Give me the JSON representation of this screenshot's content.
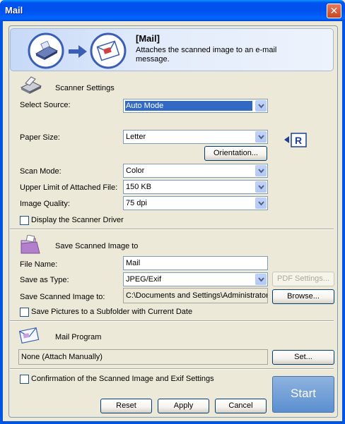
{
  "window": {
    "title": "Mail",
    "close_label": "✕"
  },
  "header": {
    "title": "[Mail]",
    "description": "Attaches the scanned image to an e-mail message."
  },
  "scanner": {
    "section_title": "Scanner Settings",
    "select_source_label": "Select Source:",
    "select_source_value": "Auto Mode",
    "paper_size_label": "Paper Size:",
    "paper_size_value": "Letter",
    "orientation_button": "Orientation...",
    "scan_mode_label": "Scan Mode:",
    "scan_mode_value": "Color",
    "upper_limit_label": "Upper Limit of Attached File:",
    "upper_limit_value": "150 KB",
    "image_quality_label": "Image Quality:",
    "image_quality_value": "75 dpi",
    "display_driver_label": "Display the Scanner Driver"
  },
  "save": {
    "section_title": "Save Scanned Image to",
    "file_name_label": "File Name:",
    "file_name_value": "Mail",
    "save_as_type_label": "Save as Type:",
    "save_as_type_value": "JPEG/Exif",
    "pdf_settings_button": "PDF Settings...",
    "save_to_label": "Save Scanned Image to:",
    "save_to_value": "C:\\Documents and Settings\\Administrator",
    "browse_button": "Browse...",
    "subfolder_label": "Save Pictures to a Subfolder with Current Date"
  },
  "mail": {
    "section_title": "Mail Program",
    "program_value": "None (Attach Manually)",
    "set_button": "Set..."
  },
  "footer": {
    "confirmation_label": "Confirmation of the Scanned Image and Exif Settings",
    "reset_button": "Reset",
    "apply_button": "Apply",
    "cancel_button": "Cancel",
    "start_button": "Start"
  }
}
